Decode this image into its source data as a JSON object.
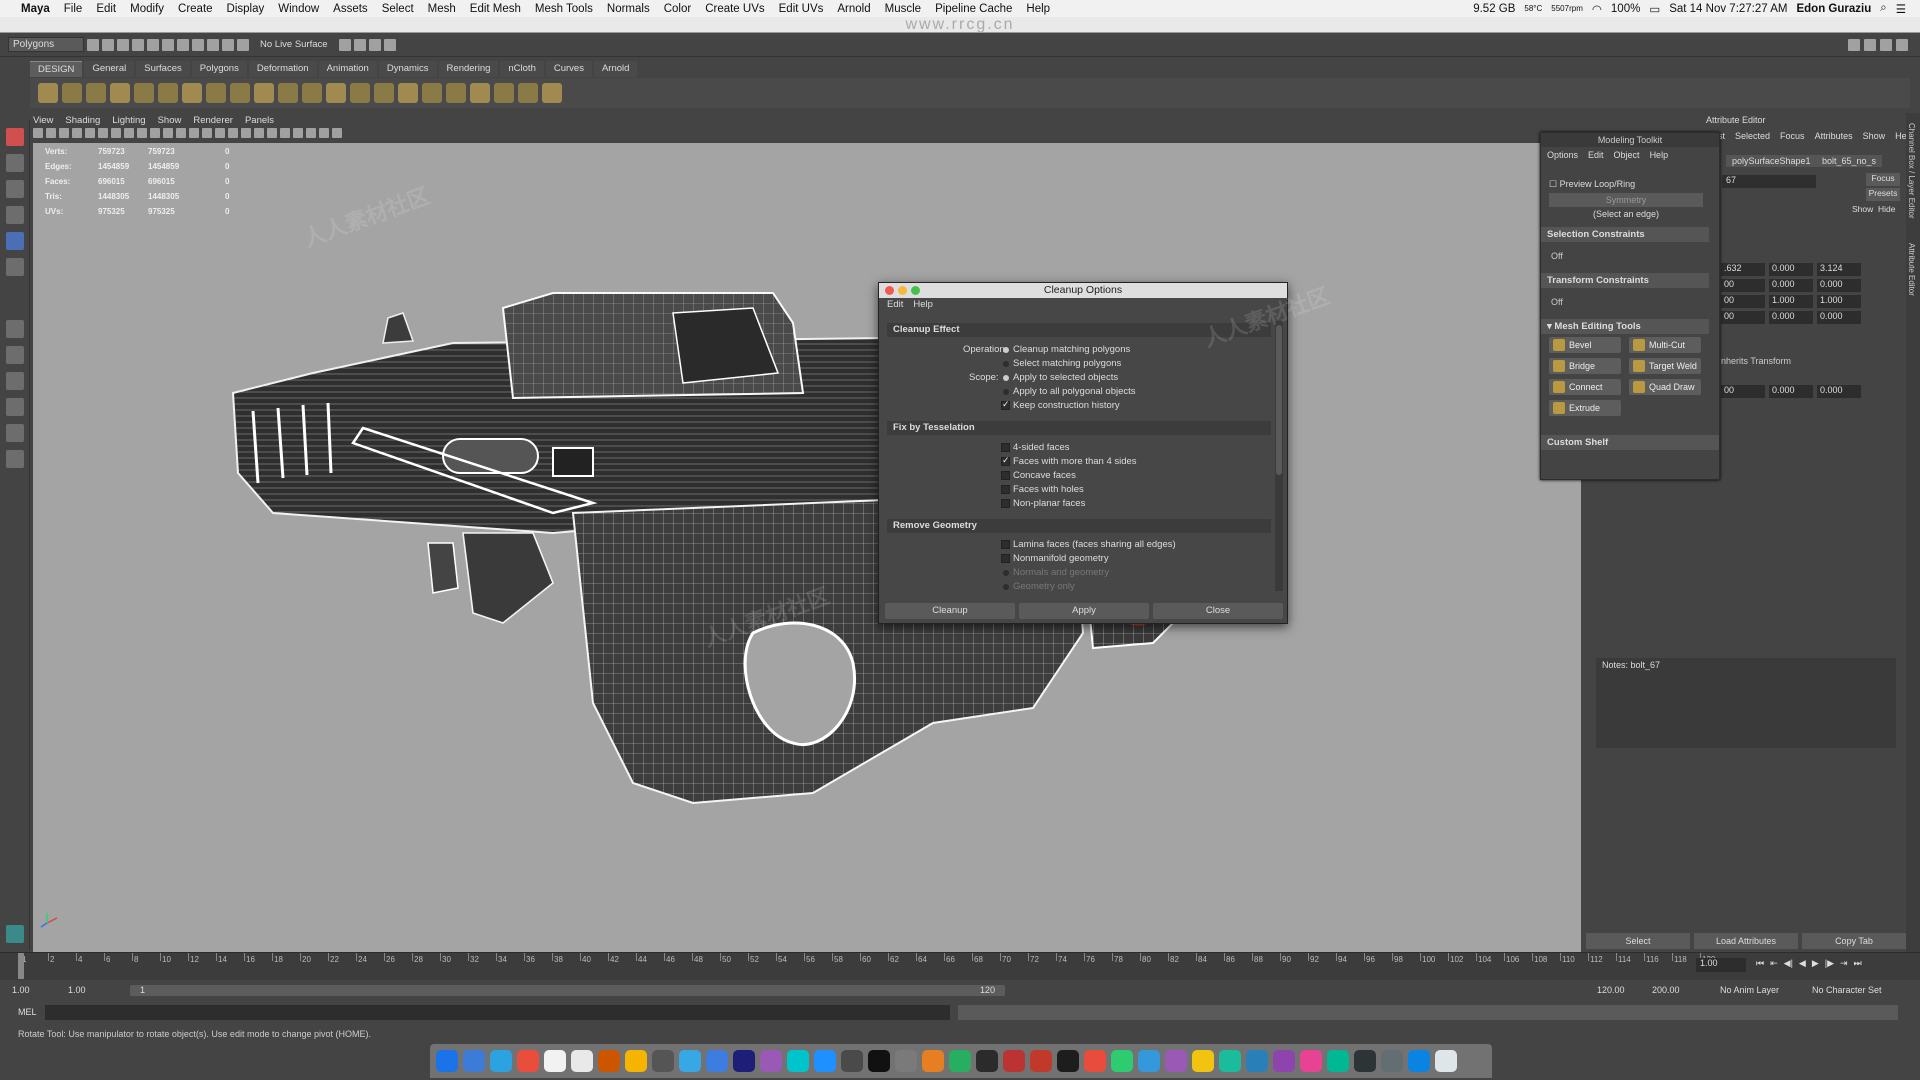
{
  "menubar": {
    "app_name": "Maya",
    "items": [
      "File",
      "Edit",
      "Modify",
      "Create",
      "Display",
      "Window",
      "Assets",
      "Select",
      "Mesh",
      "Edit Mesh",
      "Mesh Tools",
      "Normals",
      "Color",
      "Create UVs",
      "Edit UVs",
      "Arnold",
      "Muscle",
      "Pipeline Cache",
      "Help"
    ],
    "memory": "9.52 GB",
    "temp": "58°C",
    "rpm": "5507rpm",
    "battery": "100%",
    "datetime": "Sat 14 Nov  7:27:27 AM",
    "user": "Edon Guraziu"
  },
  "watermark_url": "www.rrcg.cn",
  "toolbar": {
    "mode_select": "Polygons",
    "live_surface": "No Live Surface"
  },
  "shelf": {
    "tabs": [
      "DESIGN",
      "General",
      "Surfaces",
      "Polygons",
      "Deformation",
      "Animation",
      "Dynamics",
      "Rendering",
      "nCloth",
      "Curves",
      "Arnold"
    ],
    "active_tab": "DESIGN"
  },
  "viewport": {
    "menu": [
      "View",
      "Shading",
      "Lighting",
      "Show",
      "Renderer",
      "Panels"
    ],
    "hud": [
      {
        "label": "Verts:",
        "v1": "759723",
        "v2": "759723",
        "v3": "0"
      },
      {
        "label": "Edges:",
        "v1": "1454859",
        "v2": "1454859",
        "v3": "0"
      },
      {
        "label": "Faces:",
        "v1": "696015",
        "v2": "696015",
        "v3": "0"
      },
      {
        "label": "Tris:",
        "v1": "1448305",
        "v2": "1448305",
        "v3": "0"
      },
      {
        "label": "UVs:",
        "v1": "975325",
        "v2": "975325",
        "v3": "0"
      }
    ]
  },
  "modeling_toolkit": {
    "title": "Modeling Toolkit",
    "menu": [
      "Options",
      "Edit",
      "Object",
      "Help"
    ],
    "preview_loop": "Preview Loop/Ring",
    "symmetry": "Symmetry",
    "select_edge": "(Select an edge)",
    "selection_constraints": "Selection Constraints",
    "sel_off": "Off",
    "transform_constraints": "Transform Constraints",
    "trans_off": "Off",
    "mesh_editing_tools": "Mesh Editing Tools",
    "tools": [
      "Bevel",
      "Multi-Cut",
      "Bridge",
      "Target Weld",
      "Connect",
      "Quad Draw",
      "Extrude"
    ],
    "custom_shelf": "Custom Shelf"
  },
  "attribute_editor": {
    "title": "Attribute Editor",
    "menu": [
      "List",
      "Selected",
      "Focus",
      "Attributes",
      "Show",
      "Help"
    ],
    "node_tab": "polySurfaceShape1",
    "node_tab2": "bolt_65_no_s",
    "focus": "Focus",
    "presets": "Presets",
    "show": "Show",
    "hide": "Hide",
    "name_field": "67",
    "rows": [
      [
        ".632",
        "0.000",
        "3.124"
      ],
      [
        "00",
        "0.000",
        "0.000"
      ],
      [
        "00",
        "1.000",
        "1.000"
      ],
      [
        "00",
        "0.000",
        "0.000"
      ],
      [
        "00",
        "0.000",
        "0.000"
      ]
    ],
    "inherits": "nherits Transform",
    "notes": "Notes:  bolt_67",
    "buttons": [
      "Select",
      "Load Attributes",
      "Copy Tab"
    ],
    "side_tabs": [
      "Channel Box / Layer Editor",
      "Attribute Editor"
    ]
  },
  "dialog": {
    "title": "Cleanup Options",
    "menu": [
      "Edit",
      "Help"
    ],
    "sections": {
      "cleanup_effect": "Cleanup Effect",
      "fix_tess": "Fix by Tesselation",
      "remove_geo": "Remove Geometry"
    },
    "operation_label": "Operation:",
    "operation_opts": [
      "Cleanup matching polygons",
      "Select matching polygons"
    ],
    "scope_label": "Scope:",
    "scope_opts": [
      "Apply to selected objects",
      "Apply to all polygonal objects"
    ],
    "keep_history": "Keep construction history",
    "tess_opts": [
      "4-sided faces",
      "Faces with more than 4 sides",
      "Concave faces",
      "Faces with holes",
      "Non-planar faces"
    ],
    "remove_opts": [
      "Lamina faces (faces sharing all edges)",
      "Nonmanifold geometry",
      "Normals and geometry",
      "Geometry only"
    ],
    "buttons": [
      "Cleanup",
      "Apply",
      "Close"
    ]
  },
  "timeline": {
    "ticks": [
      "1",
      "2",
      "4",
      "6",
      "8",
      "10",
      "12",
      "14",
      "16",
      "18",
      "20",
      "22",
      "24",
      "26",
      "28",
      "30",
      "32",
      "34",
      "36",
      "38",
      "40",
      "42",
      "44",
      "46",
      "48",
      "50",
      "52",
      "54",
      "56",
      "58",
      "60",
      "62",
      "64",
      "66",
      "68",
      "70",
      "72",
      "74",
      "76",
      "78",
      "80",
      "82",
      "84",
      "86",
      "88",
      "90",
      "92",
      "94",
      "96",
      "98",
      "100",
      "102",
      "104",
      "106",
      "108",
      "110",
      "112",
      "114",
      "116",
      "118",
      "120"
    ],
    "current": "1.00"
  },
  "range": {
    "start": "1.00",
    "start2": "1.00",
    "inner_start": "1",
    "inner_end": "120",
    "end": "120.00",
    "end2": "200.00",
    "anim_layer": "No Anim Layer",
    "char_set": "No Character Set"
  },
  "mel": {
    "label": "MEL"
  },
  "status": "Rotate Tool: Use manipulator to rotate object(s). Use edit mode to change pivot (HOME).",
  "colors": {
    "viewport_bg": "#a4a4a4",
    "ui_bg": "#444444",
    "manip_green": "#2fd27a",
    "icon_gold": "#b99a40"
  }
}
